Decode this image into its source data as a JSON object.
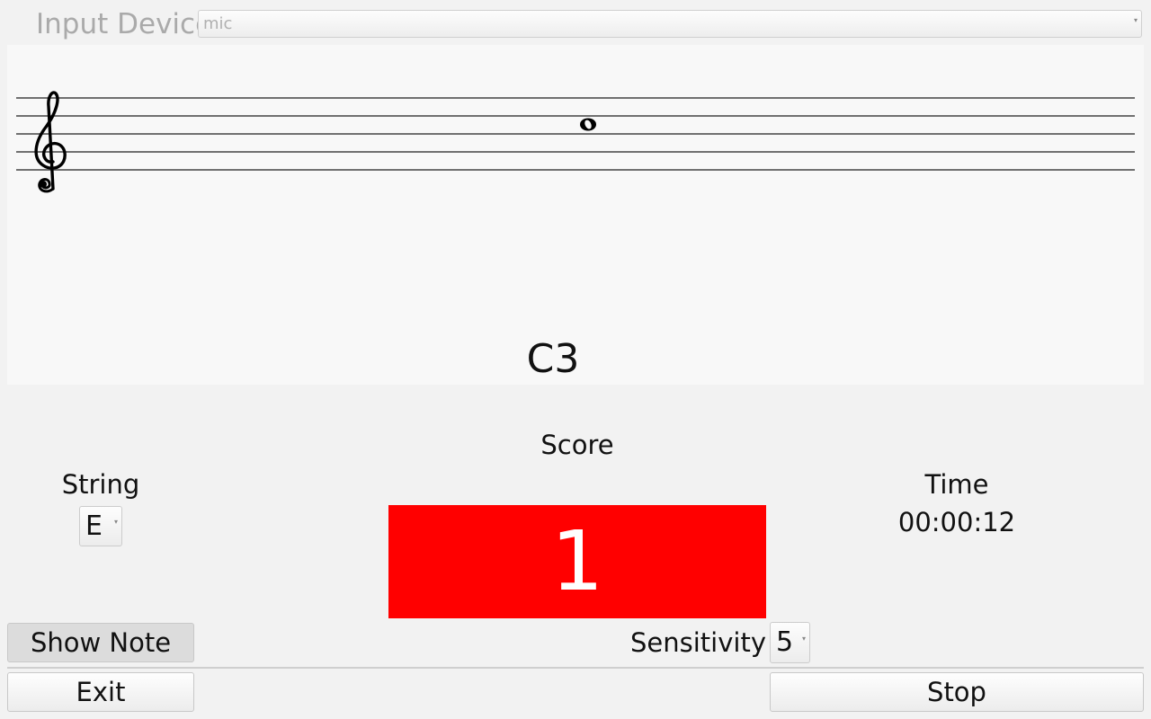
{
  "input_device": {
    "label": "Input Device",
    "selected": "mic"
  },
  "staff": {
    "clef": "treble-clef",
    "note_name": "C3"
  },
  "score": {
    "label": "Score",
    "value": "1",
    "color": "#ff0000"
  },
  "string": {
    "label": "String",
    "selected": "E"
  },
  "time": {
    "label": "Time",
    "value": "00:00:12"
  },
  "sensitivity": {
    "label": "Sensitivity",
    "selected": "5"
  },
  "buttons": {
    "show_note": "Show Note",
    "exit": "Exit",
    "stop": "Stop"
  }
}
